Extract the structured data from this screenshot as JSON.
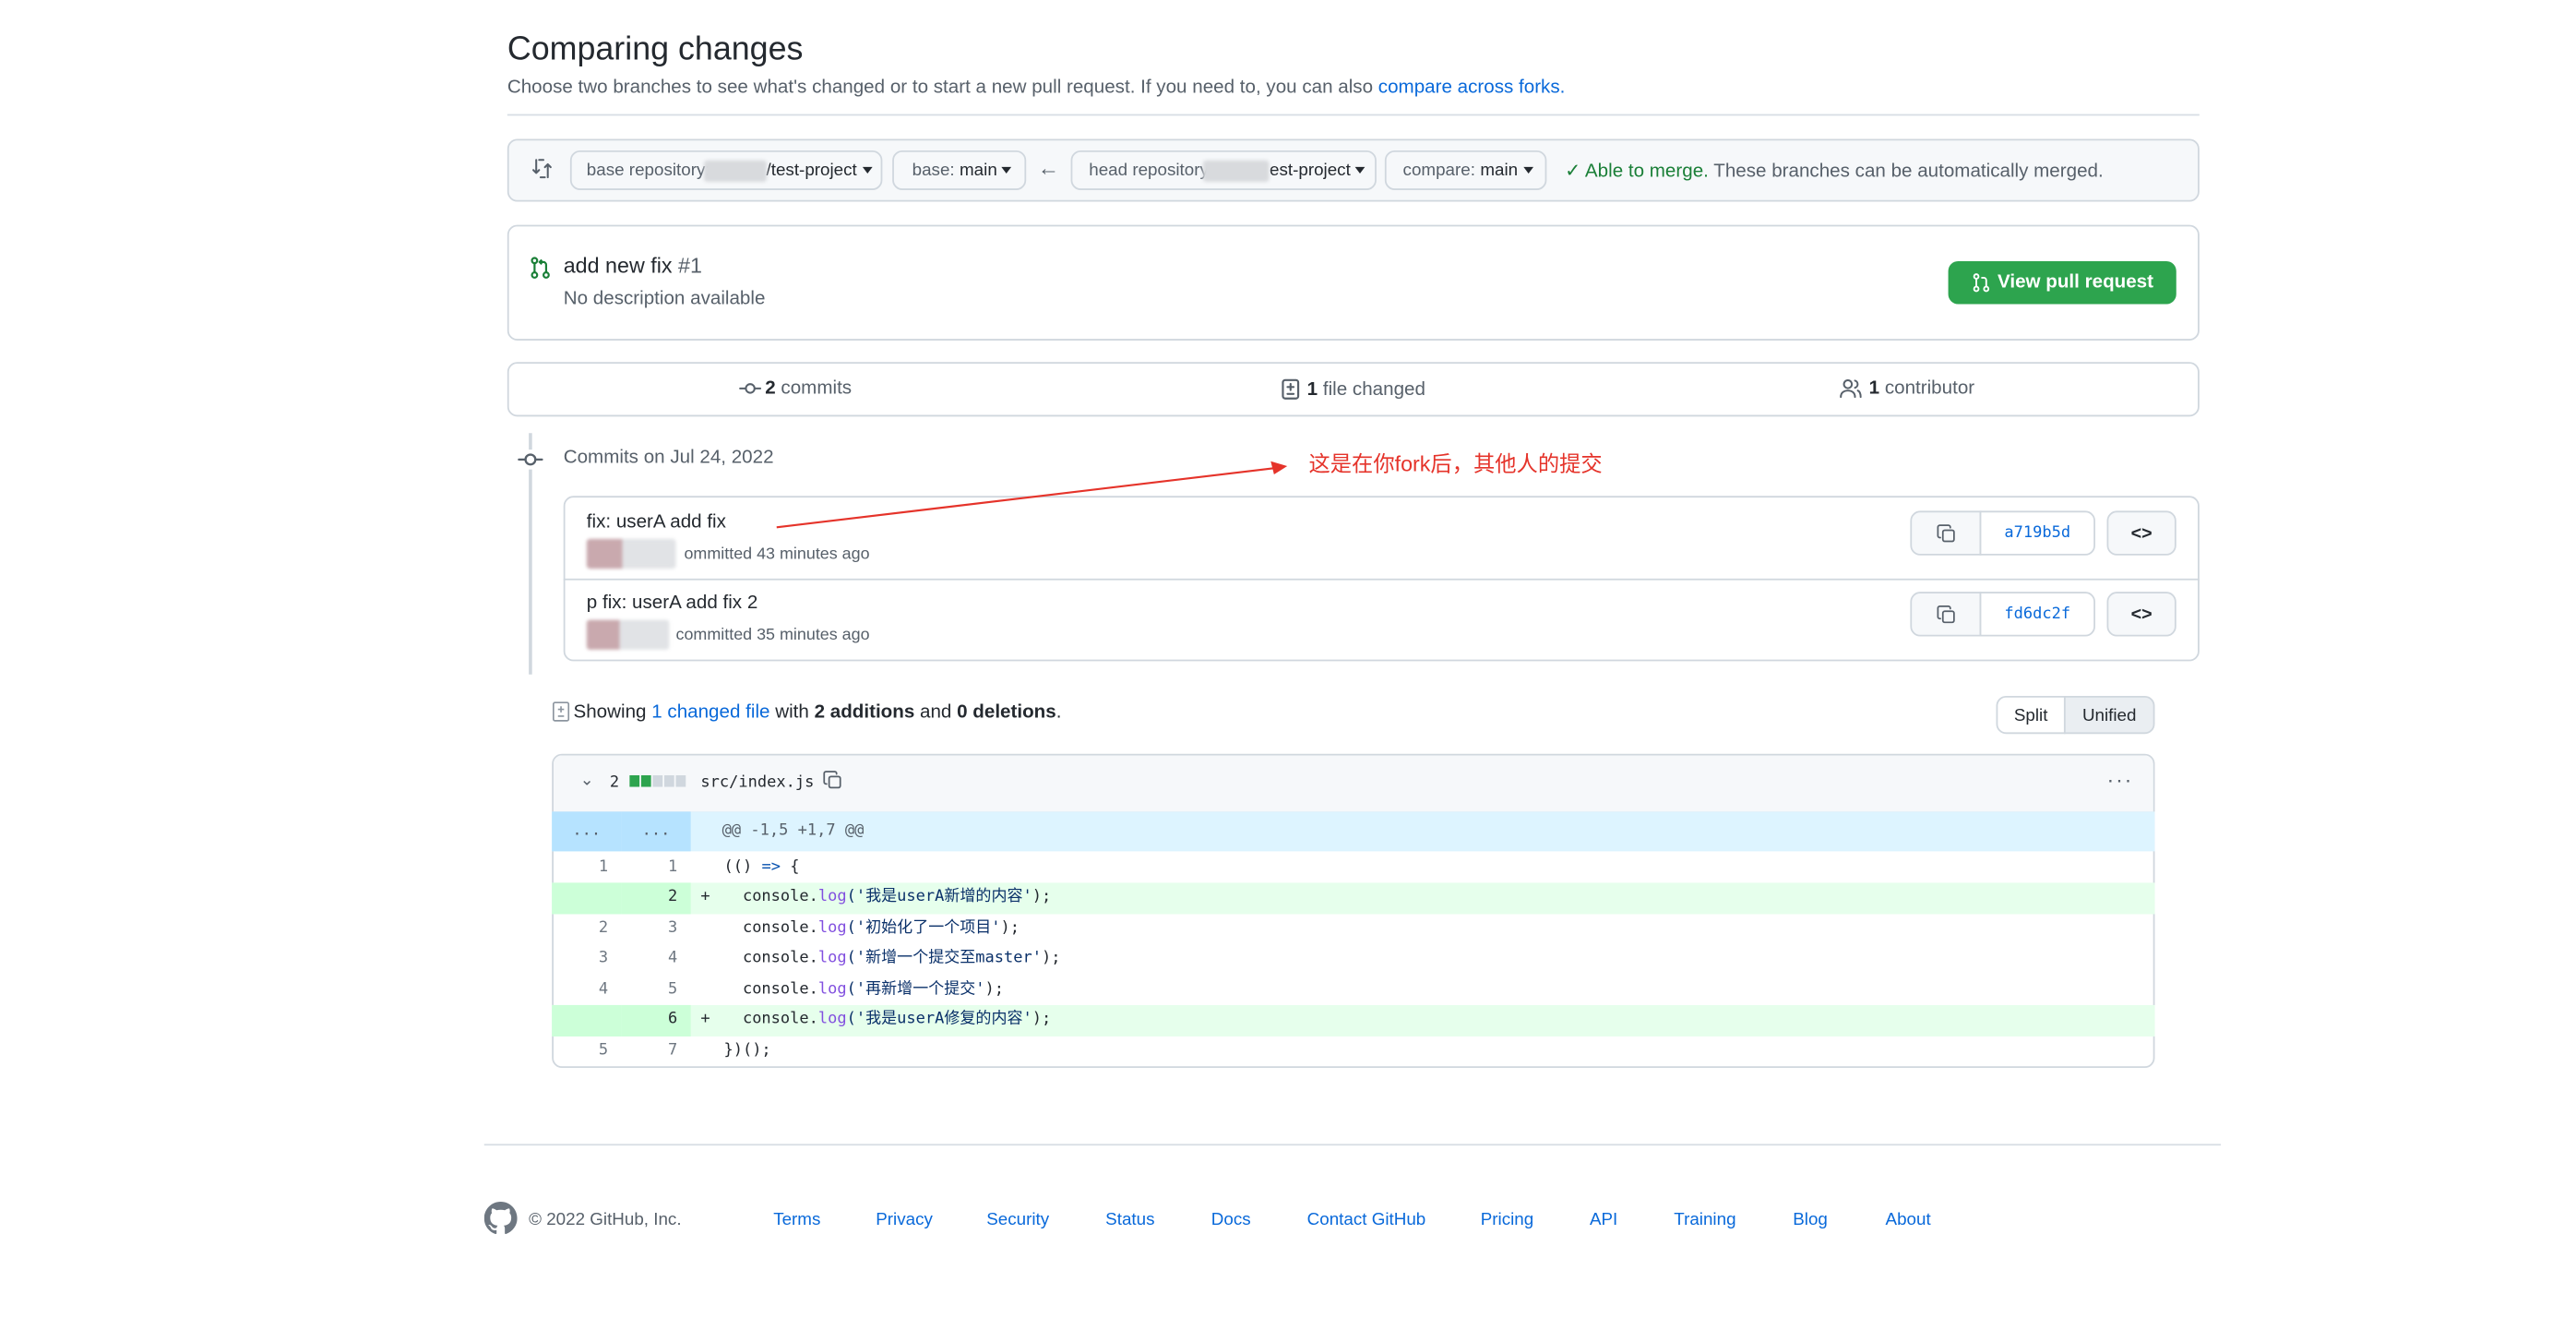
{
  "header": {
    "title": "Comparing changes",
    "subtitle": "Choose two branches to see what's changed or to start a new pull request. If you need to, you can also ",
    "subtitle_link": "compare across forks."
  },
  "range": {
    "base_repo_prefix": "base repository:",
    "base_repo_suffix": "/test-project",
    "base_branch_prefix": "base:",
    "base_branch": "main",
    "head_repo_prefix": "head repository:",
    "head_repo_suffix": "est-project",
    "compare_prefix": "compare:",
    "compare_branch": "main",
    "merge_strong": "Able to merge.",
    "merge_rest": " These branches can be automatically merged."
  },
  "pr": {
    "title": "add new fix",
    "number": "#1",
    "description": "No description available",
    "view_button": "View pull request"
  },
  "summary": {
    "commits_count": "2",
    "commits_label": " commits",
    "files_count": "1",
    "files_label": " file changed",
    "contrib_count": "1",
    "contrib_label": " contributor"
  },
  "commits": {
    "date_label": "Commits on Jul 24, 2022",
    "items": [
      {
        "message": "fix: userA add fix",
        "meta": "ommitted 43 minutes ago",
        "sha": "a719b5d"
      },
      {
        "message": "p fix: userA add fix 2",
        "meta": "committed 35 minutes ago",
        "sha": "fd6dc2f"
      }
    ]
  },
  "annotation": "这是在你fork后，其他人的提交",
  "diffbar": {
    "showing": "Showing ",
    "changed_link": "1 changed file",
    "with": " with ",
    "additions": "2 additions",
    "and": " and ",
    "deletions": "0 deletions",
    "period": ".",
    "split": "Split",
    "unified": "Unified"
  },
  "file": {
    "count": "2",
    "path": "src/index.js",
    "more": "···"
  },
  "diff": {
    "hunk_left": "...",
    "hunk_right": "...",
    "hunk": "@@ -1,5 +1,7 @@",
    "lines": [
      {
        "o": "1",
        "n": "1",
        "m": "",
        "type": "ctx",
        "pre": "(() ",
        "kw": "=>",
        "post": " {",
        "str": "",
        "end": ""
      },
      {
        "o": "",
        "n": "2",
        "m": "+",
        "type": "add",
        "pre": "  console.",
        "fn": "log",
        "str": "('我是userA新增的内容'",
        "end": ");"
      },
      {
        "o": "2",
        "n": "3",
        "m": "",
        "type": "ctx",
        "pre": "  console.",
        "fn": "log",
        "str": "('初始化了一个项目'",
        "end": ");"
      },
      {
        "o": "3",
        "n": "4",
        "m": "",
        "type": "ctx",
        "pre": "  console.",
        "fn": "log",
        "str": "('新增一个提交至master'",
        "end": ");"
      },
      {
        "o": "4",
        "n": "5",
        "m": "",
        "type": "ctx",
        "pre": "  console.",
        "fn": "log",
        "str": "('再新增一个提交'",
        "end": ");"
      },
      {
        "o": "",
        "n": "6",
        "m": "+",
        "type": "add",
        "pre": "  console.",
        "fn": "log",
        "str": "('我是userA修复的内容'",
        "end": ");"
      },
      {
        "o": "5",
        "n": "7",
        "m": "",
        "type": "ctx",
        "pre": "})();",
        "fn": "",
        "str": "",
        "end": ""
      }
    ]
  },
  "footer": {
    "copyright": "© 2022 GitHub, Inc.",
    "links": [
      "Terms",
      "Privacy",
      "Security",
      "Status",
      "Docs",
      "Contact GitHub",
      "Pricing",
      "API",
      "Training",
      "Blog",
      "About"
    ]
  },
  "colors": {
    "green": "#2da44e",
    "link": "#0969da",
    "annotation": "#e5332a",
    "add_bg": "#e6ffec",
    "hunk_bg": "#ddf4ff"
  }
}
